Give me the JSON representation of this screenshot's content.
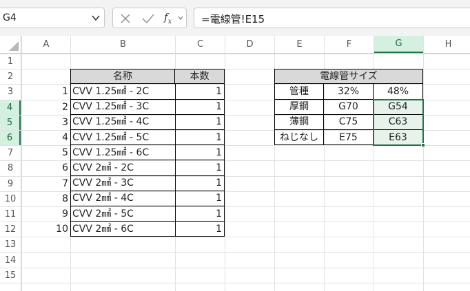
{
  "formula_bar": {
    "name_box": "G4",
    "function_symbol": "fx",
    "formula": "=電線管!E15"
  },
  "columns": [
    "A",
    "B",
    "C",
    "D",
    "E",
    "F",
    "G",
    "H"
  ],
  "selected_column": "G",
  "rows": [
    "1",
    "2",
    "3",
    "4",
    "5",
    "6",
    "7",
    "8",
    "9",
    "10",
    "11",
    "12",
    "13",
    "14",
    "15"
  ],
  "selected_rows": [
    "4",
    "5",
    "6"
  ],
  "cable_table": {
    "headers": {
      "name": "名称",
      "count": "本数"
    },
    "rows": [
      {
        "no": "1",
        "name": "CVV 1.25㎟ - 2C",
        "count": "1"
      },
      {
        "no": "2",
        "name": "CVV 1.25㎟ - 3C",
        "count": "1"
      },
      {
        "no": "3",
        "name": "CVV 1.25㎟ - 4C",
        "count": "1"
      },
      {
        "no": "4",
        "name": "CVV 1.25㎟ - 5C",
        "count": "1"
      },
      {
        "no": "5",
        "name": "CVV 1.25㎟ - 6C",
        "count": "1"
      },
      {
        "no": "6",
        "name": "CVV 2㎟ - 2C",
        "count": "1"
      },
      {
        "no": "7",
        "name": "CVV 2㎟ - 3C",
        "count": "1"
      },
      {
        "no": "8",
        "name": "CVV 2㎟ - 4C",
        "count": "1"
      },
      {
        "no": "9",
        "name": "CVV 2㎟ - 5C",
        "count": "1"
      },
      {
        "no": "10",
        "name": "CVV 2㎟ - 6C",
        "count": "1"
      }
    ]
  },
  "conduit_table": {
    "title": "電線管サイズ",
    "rows": [
      [
        "管種",
        "32%",
        "48%"
      ],
      [
        "厚鋼",
        "G70",
        "G54"
      ],
      [
        "薄鋼",
        "C75",
        "C63"
      ],
      [
        "ねじなし",
        "E75",
        "E63"
      ]
    ]
  },
  "colors": {
    "selection_border": "#217346",
    "selection_fill": "#e6f2ea",
    "header_selected_fill": "#d3f0e0",
    "table_header_fill": "#d9d9d9"
  }
}
